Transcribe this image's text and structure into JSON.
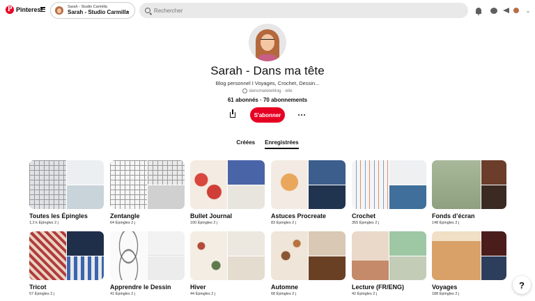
{
  "header": {
    "logo_text": "Pinterest",
    "account": {
      "small_label": "Sarah - Studio Carmilla",
      "name": "Sarah - Studio Carmilla"
    },
    "search_placeholder": "Rechercher"
  },
  "profile": {
    "name": "Sarah - Dans ma tête",
    "bio": "Blog personnel I Voyages, Crochet, Dessin...",
    "handle": "dansmateteblog · elle",
    "stats": "61 abonnés · 70 abonnements",
    "subscribe_label": "S'abonner"
  },
  "tabs": [
    {
      "label": "Créées"
    },
    {
      "label": "Enregistrées"
    }
  ],
  "boards": [
    {
      "title": "Toutes les Épingles",
      "meta": "1,2 k Épingles   2 j"
    },
    {
      "title": "Zentangle",
      "meta": "64 Épingles   2 j"
    },
    {
      "title": "Bullet Journal",
      "meta": "100 Épingles   2 j"
    },
    {
      "title": "Astuces Procreate",
      "meta": "83 Épingles   2 j"
    },
    {
      "title": "Crochet",
      "meta": "355 Épingles   2 j"
    },
    {
      "title": "Fonds d’écran",
      "meta": "148 Épingles   2 j"
    },
    {
      "title": "Tricot",
      "meta": "57 Épingles   2 j"
    },
    {
      "title": "Apprendre le Dessin",
      "meta": "41 Épingles   2 j"
    },
    {
      "title": "Hiver",
      "meta": "44 Épingles   2 j"
    },
    {
      "title": "Automne",
      "meta": "68 Épingles   2 j"
    },
    {
      "title": "Lecture (FR/ENG)",
      "meta": "42 Épingles   2 j"
    },
    {
      "title": "Voyages",
      "meta": "188 Épingles   2 j"
    }
  ],
  "help_label": "?",
  "colors": {
    "accent": "#e60023"
  }
}
